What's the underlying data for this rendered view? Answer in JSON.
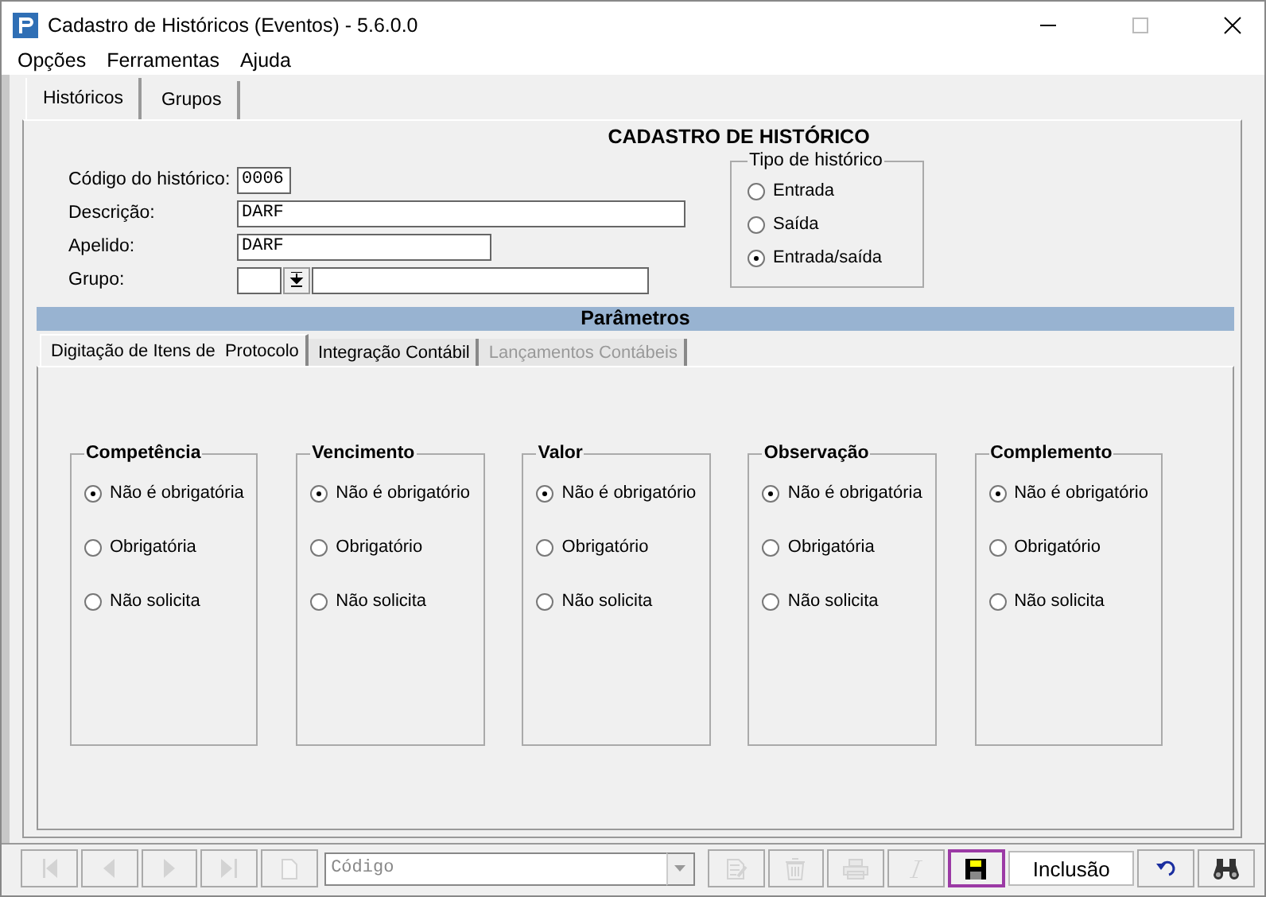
{
  "window": {
    "title": "Cadastro de Históricos (Eventos) - 5.6.0.0"
  },
  "menu": [
    "Opções",
    "Ferramentas",
    "Ajuda"
  ],
  "tabs": [
    {
      "label": "Históricos",
      "selected": true
    },
    {
      "label": "Grupos",
      "selected": false
    }
  ],
  "form": {
    "heading": "CADASTRO DE HISTÓRICO",
    "fields": [
      {
        "label": "Código do histórico:",
        "value": "0006",
        "kind": "short"
      },
      {
        "label": "Descrição:",
        "value": "DARF",
        "kind": "long"
      },
      {
        "label": "Apelido:",
        "value": "DARF",
        "kind": "medium"
      },
      {
        "label": "Grupo:",
        "kind": "lookup"
      }
    ]
  },
  "tipo": {
    "title": "Tipo de histórico",
    "options": [
      {
        "label": "Entrada",
        "selected": false
      },
      {
        "label": "Saída",
        "selected": false
      },
      {
        "label": "Entrada/saída",
        "selected": true
      }
    ]
  },
  "parametros": {
    "heading": "Parâmetros",
    "tabs": [
      {
        "label": "Digitação de Itens de  Protocolo",
        "selected": true,
        "disabled": false
      },
      {
        "label": "Integração Contábil",
        "selected": false,
        "disabled": false
      },
      {
        "label": "Lançamentos Contábeis",
        "selected": false,
        "disabled": true
      }
    ],
    "groups": [
      {
        "title": "Competência",
        "options": [
          {
            "label": "Não é obrigatória",
            "selected": true
          },
          {
            "label": "Obrigatória",
            "selected": false
          },
          {
            "label": "Não solicita",
            "selected": false
          }
        ]
      },
      {
        "title": "Vencimento",
        "options": [
          {
            "label": "Não é obrigatório",
            "selected": true
          },
          {
            "label": "Obrigatório",
            "selected": false
          },
          {
            "label": "Não solicita",
            "selected": false
          }
        ]
      },
      {
        "title": "Valor",
        "options": [
          {
            "label": "Não é obrigatório",
            "selected": true
          },
          {
            "label": "Obrigatório",
            "selected": false
          },
          {
            "label": "Não solicita",
            "selected": false
          }
        ]
      },
      {
        "title": "Observação",
        "options": [
          {
            "label": "Não é obrigatória",
            "selected": true
          },
          {
            "label": "Obrigatória",
            "selected": false
          },
          {
            "label": "Não solicita",
            "selected": false
          }
        ]
      },
      {
        "title": "Complemento",
        "options": [
          {
            "label": "Não é obrigatório",
            "selected": true
          },
          {
            "label": "Obrigatório",
            "selected": false
          },
          {
            "label": "Não solicita",
            "selected": false
          }
        ]
      }
    ]
  },
  "toolbar": {
    "code_placeholder": "Código",
    "status": "Inclusão",
    "buttons": [
      {
        "kind": "first",
        "disabled": true,
        "focused": false
      },
      {
        "kind": "prev",
        "disabled": true,
        "focused": false
      },
      {
        "kind": "next",
        "disabled": true,
        "focused": false
      },
      {
        "kind": "last",
        "disabled": true,
        "focused": false
      },
      {
        "kind": "new",
        "disabled": true,
        "focused": false
      },
      {
        "kind": "combo"
      },
      {
        "kind": "edit",
        "disabled": true,
        "focused": false
      },
      {
        "kind": "delete",
        "disabled": true,
        "focused": false
      },
      {
        "kind": "print",
        "disabled": true,
        "focused": false
      },
      {
        "kind": "italic",
        "disabled": true,
        "focused": false
      },
      {
        "kind": "save",
        "disabled": false,
        "focused": true
      },
      {
        "kind": "status"
      },
      {
        "kind": "undo",
        "disabled": false,
        "focused": false
      },
      {
        "kind": "find",
        "disabled": false,
        "focused": false
      }
    ]
  }
}
